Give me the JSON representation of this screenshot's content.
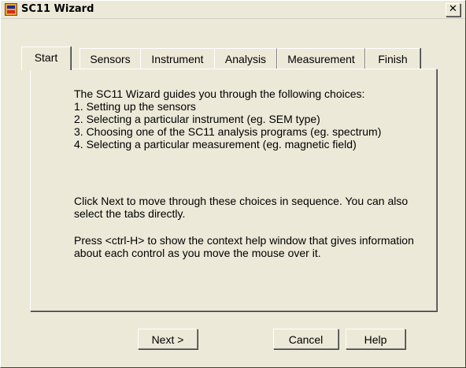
{
  "window": {
    "title": "SC11 Wizard",
    "close_label": "✕"
  },
  "tabs": [
    {
      "label": "Start",
      "active": true
    },
    {
      "label": "Sensors",
      "active": false
    },
    {
      "label": "Instrument",
      "active": false
    },
    {
      "label": "Analysis",
      "active": false
    },
    {
      "label": "Measurement",
      "active": false
    },
    {
      "label": "Finish",
      "active": false
    }
  ],
  "content": {
    "intro": "The SC11 Wizard guides you through the following choices:\n1. Setting up the sensors\n2. Selecting a particular instrument (eg. SEM type)\n3. Choosing one of the SC11 analysis programs (eg. spectrum)\n4. Selecting a particular measurement (eg. magnetic field)",
    "sequence": "Click Next to move through these choices in sequence. You can also select the tabs directly.",
    "help_hint": "Press <ctrl-H> to show the context help window that gives information about each control as you move the mouse over it."
  },
  "buttons": {
    "next": "Next >",
    "cancel": "Cancel",
    "help": "Help"
  }
}
